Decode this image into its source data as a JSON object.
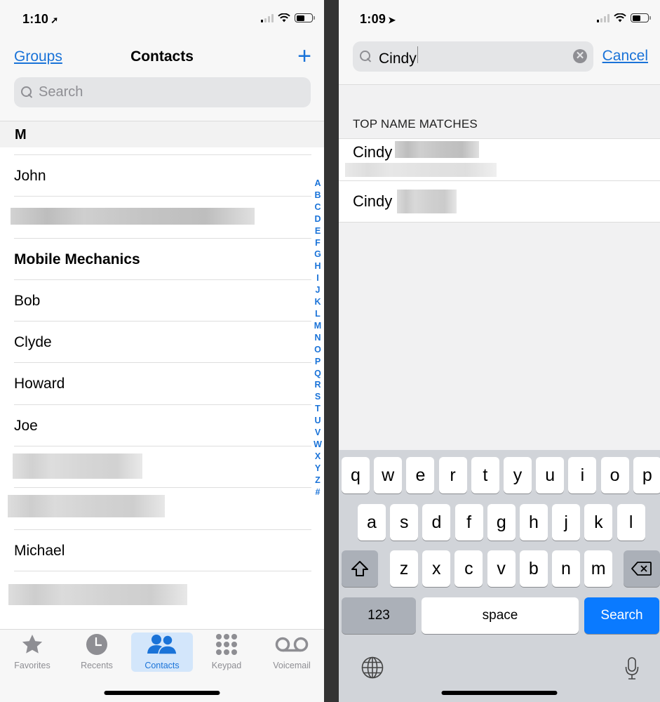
{
  "left": {
    "status": {
      "time": "1:10",
      "location_icon": "location-arrow-outline-icon",
      "signal_bars": 1,
      "battery_level": 0.55
    },
    "nav": {
      "left_link": "Groups",
      "title": "Contacts",
      "add_icon": "plus-icon"
    },
    "search": {
      "placeholder": "Search"
    },
    "section_header": "M",
    "contacts": [
      {
        "name": "John",
        "bold": false
      },
      {
        "name": "",
        "redacted": true
      },
      {
        "name": "Mobile Mechanics",
        "bold": true
      },
      {
        "name": "Bob",
        "bold": false
      },
      {
        "name": "Clyde",
        "bold": false
      },
      {
        "name": "Howard",
        "bold": false
      },
      {
        "name": "Joe",
        "bold": false
      },
      {
        "name": "",
        "redacted": true
      },
      {
        "name": "",
        "redacted": true
      },
      {
        "name": "Michael",
        "bold": false
      },
      {
        "name": "",
        "redacted": true
      }
    ],
    "index_letters": [
      "A",
      "B",
      "C",
      "D",
      "E",
      "F",
      "G",
      "H",
      "I",
      "J",
      "K",
      "L",
      "M",
      "N",
      "O",
      "P",
      "Q",
      "R",
      "S",
      "T",
      "U",
      "V",
      "W",
      "X",
      "Y",
      "Z",
      "#"
    ],
    "tabs": [
      {
        "label": "Favorites",
        "icon": "star-icon",
        "active": false
      },
      {
        "label": "Recents",
        "icon": "clock-icon",
        "active": false
      },
      {
        "label": "Contacts",
        "icon": "people-icon",
        "active": true
      },
      {
        "label": "Keypad",
        "icon": "keypad-icon",
        "active": false
      },
      {
        "label": "Voicemail",
        "icon": "voicemail-icon",
        "active": false
      }
    ]
  },
  "right": {
    "status": {
      "time": "1:09",
      "location_icon": "location-arrow-filled-icon",
      "signal_bars": 1,
      "battery_level": 0.55
    },
    "search": {
      "value": "Cindy",
      "cancel_label": "Cancel"
    },
    "matches_header": "TOP NAME MATCHES",
    "matches": [
      {
        "name": "Cindy",
        "has_subtitle": true
      },
      {
        "name": "Cindy",
        "has_subtitle": false
      }
    ],
    "keyboard": {
      "row1": [
        "q",
        "w",
        "e",
        "r",
        "t",
        "y",
        "u",
        "i",
        "o",
        "p"
      ],
      "row2": [
        "a",
        "s",
        "d",
        "f",
        "g",
        "h",
        "j",
        "k",
        "l"
      ],
      "row3": [
        "z",
        "x",
        "c",
        "v",
        "b",
        "n",
        "m"
      ],
      "numbers_label": "123",
      "space_label": "space",
      "action_label": "Search"
    }
  },
  "colors": {
    "accent": "#1a73d8",
    "search_key": "#0a7aff",
    "index": "#1a73d8"
  }
}
